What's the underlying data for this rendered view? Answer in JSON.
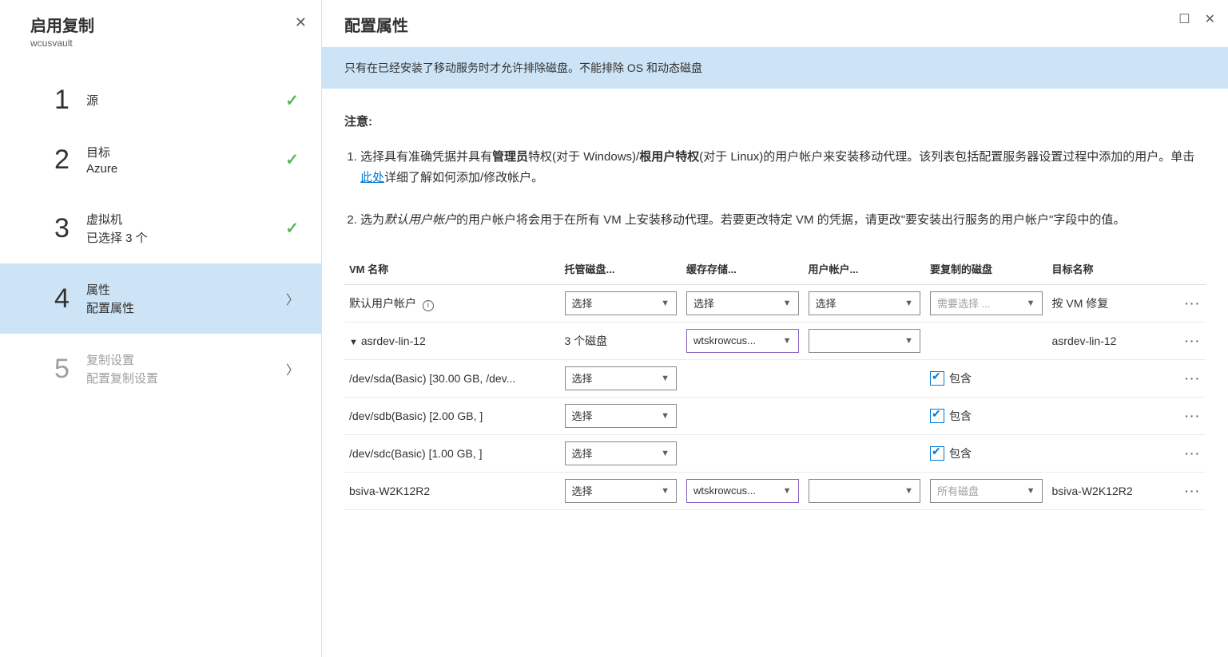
{
  "left": {
    "title": "启用复制",
    "subtitle": "wcusvault",
    "steps": [
      {
        "num": "1",
        "label": "源",
        "value": "",
        "done": true
      },
      {
        "num": "2",
        "label": "目标",
        "value": "Azure",
        "done": true
      },
      {
        "num": "3",
        "label": "虚拟机",
        "value": "已选择 3 个",
        "done": true
      },
      {
        "num": "4",
        "label": "属性",
        "value": "配置属性",
        "active": true
      },
      {
        "num": "5",
        "label": "复制设置",
        "value": "配置复制设置",
        "muted": true
      }
    ]
  },
  "right": {
    "title": "配置属性",
    "infoBar": "只有在已经安装了移动服务时才允许排除磁盘。不能排除 OS 和动态磁盘",
    "noteLabel": "注意:",
    "note1_a": "选择具有准确凭据并具有",
    "note1_b": "管理员",
    "note1_c": "特权(对于 Windows)/",
    "note1_d": "根用户特权",
    "note1_e": "(对于 Linux)的用户帐户来安装移动代理。该列表包括配置服务器设置过程中添加的用户。单击",
    "note1_link": "此处",
    "note1_f": "详细了解如何添加/修改帐户。",
    "note2_a": "选为",
    "note2_b": "默认用户帐户",
    "note2_c": "的用户帐户将会用于在所有 VM 上安装移动代理。若要更改特定 VM 的凭据，请更改\"要安装出行服务的用户帐户\"字段中的值。",
    "headers": {
      "vm": "VM 名称",
      "managed": "托管磁盘...",
      "cache": "缓存存储...",
      "user": "用户帐户...",
      "disk": "要复制的磁盘",
      "target": "目标名称"
    },
    "selectLabel": "选择",
    "includeLabel": "包含",
    "wtsk": "wtskrowcus...",
    "rows": {
      "r0": {
        "name": "默认用户帐户",
        "disk_ph": "需要选择 ...",
        "target": "按 VM 修复"
      },
      "r1": {
        "name": "asrdev-lin-12",
        "disks": "3 个磁盘",
        "target": "asrdev-lin-12"
      },
      "r1a": {
        "name": "/dev/sda(Basic) [30.00 GB, /dev..."
      },
      "r1b": {
        "name": "/dev/sdb(Basic) [2.00 GB, ]"
      },
      "r1c": {
        "name": "/dev/sdc(Basic) [1.00 GB, ]"
      },
      "r2": {
        "name": "bsiva-W2K12R2",
        "disk_ph": "所有磁盘",
        "target": "bsiva-W2K12R2"
      }
    }
  }
}
